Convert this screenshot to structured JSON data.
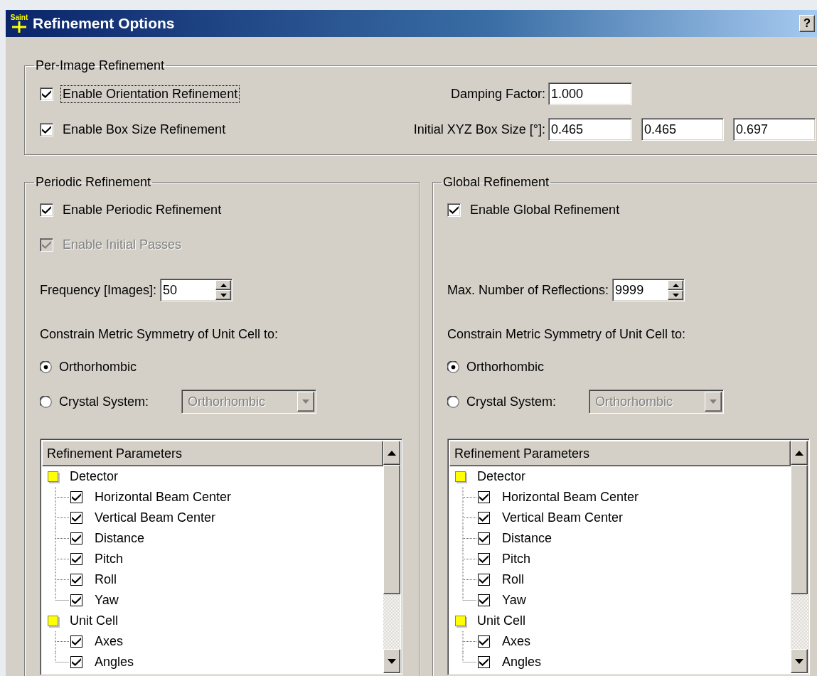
{
  "window": {
    "title": "Refinement Options",
    "logo_text": "Saint",
    "help_label": "?"
  },
  "per_image": {
    "title": "Per-Image Refinement",
    "checkboxes": [
      {
        "label": "Enable Orientation Refinement",
        "checked": true,
        "focused": true
      },
      {
        "label": "Enable Box Size Refinement",
        "checked": true,
        "focused": false
      }
    ],
    "damping": {
      "label": "Damping Factor:",
      "value": "1.000"
    },
    "box_size": {
      "label": "Initial XYZ Box Size [°]:",
      "values": [
        "0.465",
        "0.465",
        "0.697"
      ]
    }
  },
  "panels": [
    {
      "title": "Periodic Refinement",
      "options": [
        {
          "label": "Enable Periodic Refinement",
          "checked": true,
          "disabled": false
        },
        {
          "label": "Enable Initial Passes",
          "checked": true,
          "disabled": true
        }
      ],
      "count": {
        "label": "Frequency [Images]:",
        "value": "50"
      },
      "constrain_label": "Constrain Metric Symmetry of Unit Cell to:",
      "symmetry": [
        {
          "label": "Orthorhombic",
          "selected": true
        },
        {
          "label": "Crystal System:",
          "selected": false
        }
      ],
      "crystal_system": {
        "value": "Orthorhombic",
        "disabled": true
      },
      "tree": {
        "header": "Refinement Parameters",
        "groups": [
          {
            "label": "Detector",
            "color": "#ffff00",
            "children": [
              {
                "label": "Horizontal Beam Center",
                "checked": true
              },
              {
                "label": "Vertical Beam Center",
                "checked": true
              },
              {
                "label": "Distance",
                "checked": true
              },
              {
                "label": "Pitch",
                "checked": true
              },
              {
                "label": "Roll",
                "checked": true
              },
              {
                "label": "Yaw",
                "checked": true
              }
            ]
          },
          {
            "label": "Unit Cell",
            "color": "#ffff00",
            "children": [
              {
                "label": "Axes",
                "checked": true
              },
              {
                "label": "Angles",
                "checked": true
              }
            ]
          }
        ]
      }
    },
    {
      "title": "Global Refinement",
      "options": [
        {
          "label": "Enable Global Refinement",
          "checked": true,
          "disabled": false
        }
      ],
      "count": {
        "label": "Max. Number of Reflections:",
        "value": "9999"
      },
      "constrain_label": "Constrain Metric Symmetry of Unit Cell to:",
      "symmetry": [
        {
          "label": "Orthorhombic",
          "selected": true
        },
        {
          "label": "Crystal System:",
          "selected": false
        }
      ],
      "crystal_system": {
        "value": "Orthorhombic",
        "disabled": true
      },
      "tree": {
        "header": "Refinement Parameters",
        "groups": [
          {
            "label": "Detector",
            "color": "#ffff00",
            "children": [
              {
                "label": "Horizontal Beam Center",
                "checked": true
              },
              {
                "label": "Vertical Beam Center",
                "checked": true
              },
              {
                "label": "Distance",
                "checked": true
              },
              {
                "label": "Pitch",
                "checked": true
              },
              {
                "label": "Roll",
                "checked": true
              },
              {
                "label": "Yaw",
                "checked": true
              }
            ]
          },
          {
            "label": "Unit Cell",
            "color": "#ffff00",
            "children": [
              {
                "label": "Axes",
                "checked": true
              },
              {
                "label": "Angles",
                "checked": true
              }
            ]
          }
        ]
      }
    }
  ]
}
